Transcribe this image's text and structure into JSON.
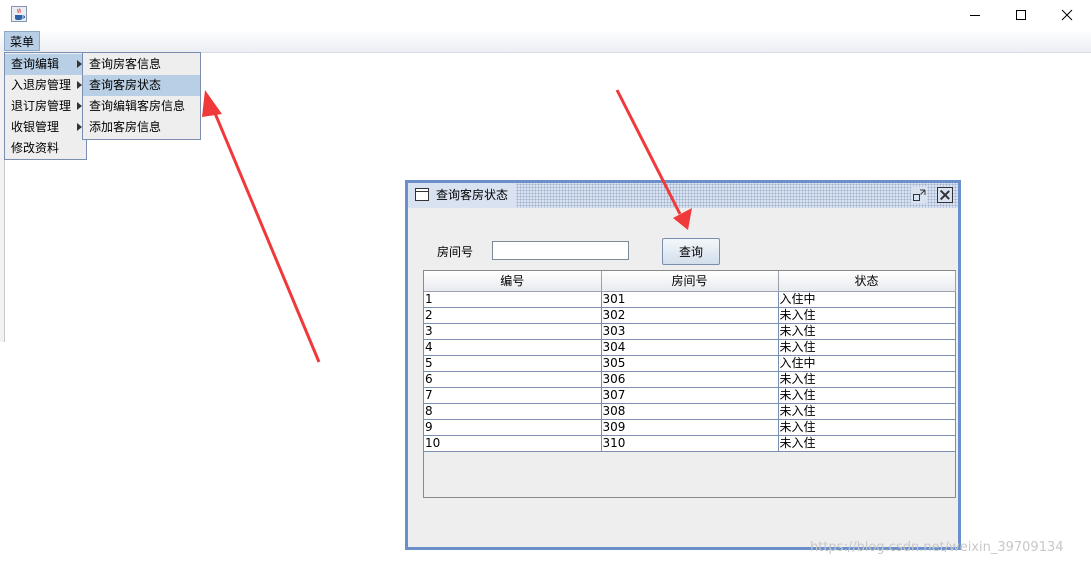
{
  "window": {
    "icon": "java-coffee-icon",
    "controls": [
      "minimize-icon",
      "maximize-icon",
      "close-icon"
    ]
  },
  "menubar": {
    "root_label": "菜单"
  },
  "main_menu": {
    "items": [
      {
        "label": "查询编辑",
        "has_submenu": true,
        "active": true
      },
      {
        "label": "入退房管理",
        "has_submenu": true
      },
      {
        "label": "退订房管理",
        "has_submenu": true
      },
      {
        "label": "收银管理",
        "has_submenu": true
      },
      {
        "label": "修改资料",
        "has_submenu": false
      }
    ]
  },
  "sub_menu": {
    "items": [
      {
        "label": "查询房客信息"
      },
      {
        "label": "查询客房状态",
        "active": true
      },
      {
        "label": "查询编辑客房信息"
      },
      {
        "label": "添加客房信息"
      }
    ]
  },
  "internal_frame": {
    "title": "查询客房状态",
    "room_label": "房间号",
    "room_value": "",
    "query_button": "查询",
    "table": {
      "columns": [
        "编号",
        "房间号",
        "状态"
      ],
      "rows": [
        [
          "1",
          "301",
          "入住中"
        ],
        [
          "2",
          "302",
          "未入住"
        ],
        [
          "3",
          "303",
          "未入住"
        ],
        [
          "4",
          "304",
          "未入住"
        ],
        [
          "5",
          "305",
          "入住中"
        ],
        [
          "6",
          "306",
          "未入住"
        ],
        [
          "7",
          "307",
          "未入住"
        ],
        [
          "8",
          "308",
          "未入住"
        ],
        [
          "9",
          "309",
          "未入住"
        ],
        [
          "10",
          "310",
          "未入住"
        ]
      ]
    }
  },
  "watermark": "https://blog.csdn.net/weixin_39709134",
  "colors": {
    "frame_border": "#6b8fcb",
    "menu_highlight": "#b8cfe5",
    "annotation_arrow": "#f0393b"
  }
}
